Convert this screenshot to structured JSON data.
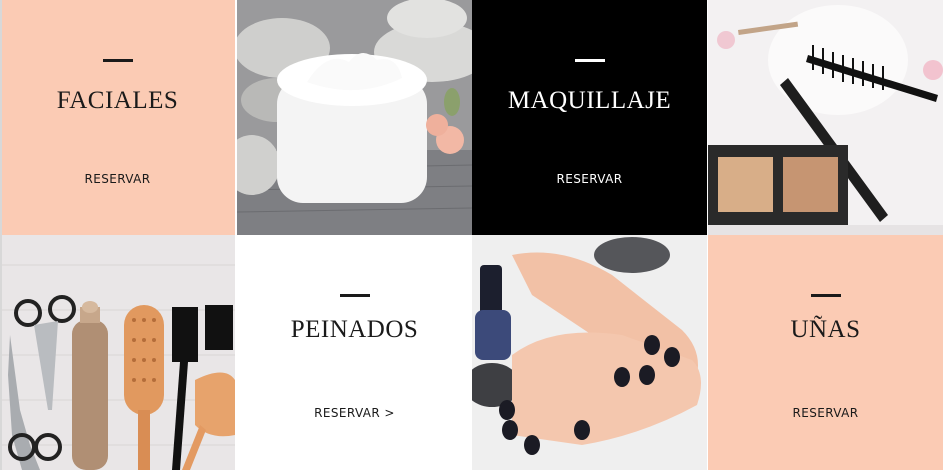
{
  "colors": {
    "peach": "#fbcbb4",
    "black": "#000000",
    "white": "#ffffff",
    "dark_text": "#1a1a1a",
    "light_text": "#ffffff"
  },
  "services": [
    {
      "title": "FACIALES",
      "cta": "RESERVAR"
    },
    {
      "title": "MAQUILLAJE",
      "cta": "RESERVAR"
    },
    {
      "title": "PEINADOS",
      "cta": "RESERVAR >"
    },
    {
      "title": "UÑAS",
      "cta": "RESERVAR"
    }
  ],
  "icons": {
    "cream_jar_photo": "cream-jar-photo",
    "makeup_photo": "makeup-photo",
    "hair_tools_photo": "hair-tools-photo",
    "nails_photo": "nails-photo"
  }
}
